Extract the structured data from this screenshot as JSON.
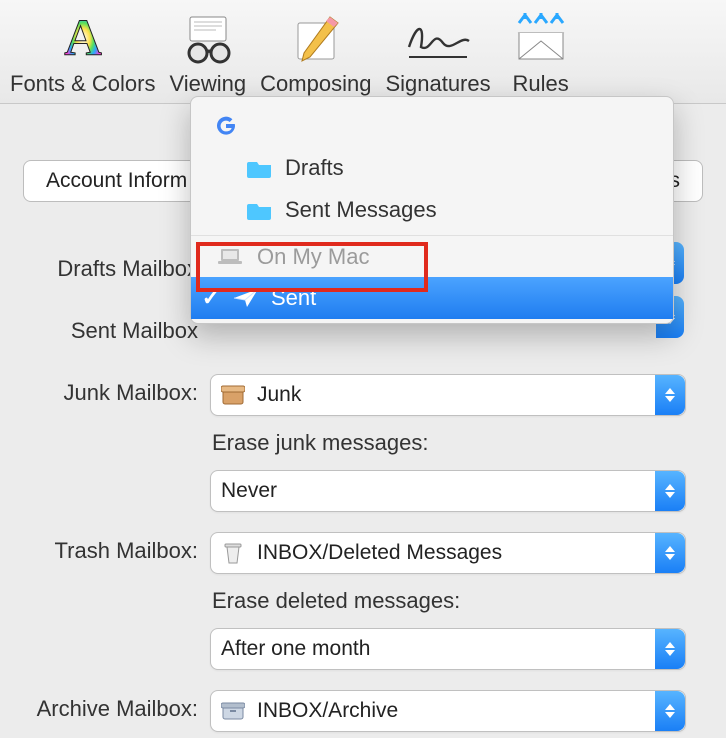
{
  "toolbar": {
    "items": [
      {
        "label": "Fonts & Colors"
      },
      {
        "label": "Viewing"
      },
      {
        "label": "Composing"
      },
      {
        "label": "Signatures"
      },
      {
        "label": "Rules"
      }
    ]
  },
  "tabs": {
    "left_label": "Account Inform",
    "right_label": "s"
  },
  "dropdown": {
    "google_header": "",
    "drafts_label": "Drafts",
    "sent_messages_label": "Sent Messages",
    "on_my_mac_label": "On My Mac",
    "selected_label": "Sent"
  },
  "form": {
    "drafts_label": "Drafts Mailbox",
    "sent_label": "Sent Mailbox",
    "junk": {
      "label": "Junk Mailbox:",
      "value": "Junk",
      "erase_label": "Erase junk messages:",
      "erase_value": "Never"
    },
    "trash": {
      "label": "Trash Mailbox:",
      "value": "INBOX/Deleted Messages",
      "erase_label": "Erase deleted messages:",
      "erase_value": "After one month"
    },
    "archive": {
      "label": "Archive Mailbox:",
      "value": "INBOX/Archive"
    }
  }
}
